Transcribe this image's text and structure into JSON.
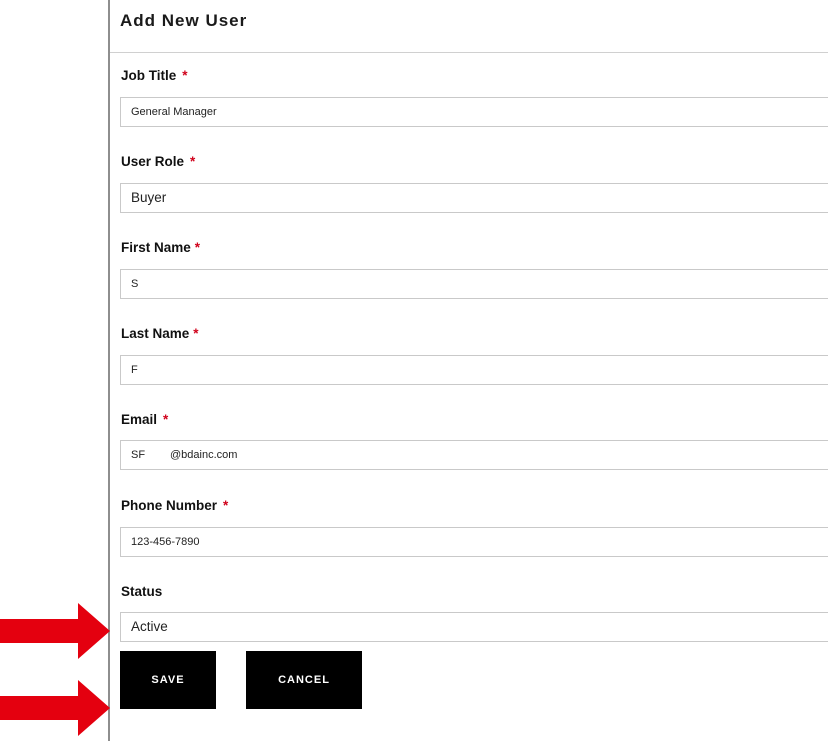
{
  "form": {
    "title": "Add New User",
    "required_marker": "*",
    "fields": {
      "job_title": {
        "label": "Job Title",
        "value": "General Manager"
      },
      "user_role": {
        "label": "User Role",
        "value": "Buyer"
      },
      "first_name": {
        "label": "First Name",
        "value": "S"
      },
      "last_name": {
        "label": "Last Name",
        "value": "F"
      },
      "email": {
        "label": "Email",
        "value_left": "SF",
        "value_right": "@bdainc.com"
      },
      "phone": {
        "label": "Phone Number",
        "value": "123-456-7890"
      },
      "status": {
        "label": "Status",
        "value": "Active"
      }
    },
    "buttons": {
      "save": "SAVE",
      "cancel": "CANCEL"
    }
  },
  "colors": {
    "required": "#d0021b",
    "arrow": "#e4000f",
    "button_bg": "#000000"
  },
  "icons": {
    "dropdown": "chevron-down-icon",
    "annotation": "red-arrow-icon"
  }
}
